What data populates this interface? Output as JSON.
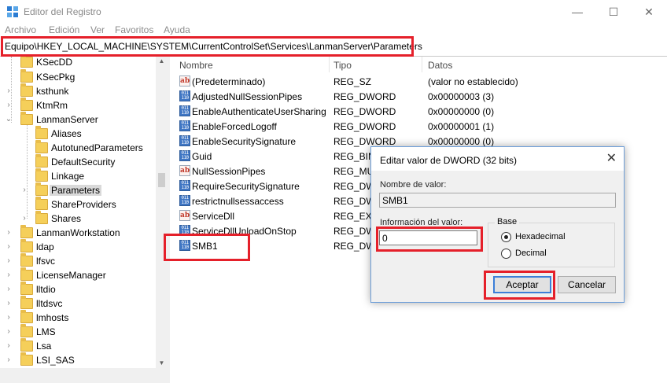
{
  "window": {
    "title": "Editor del Registro",
    "controls": {
      "minimize": "—",
      "maximize": "☐",
      "close": "✕"
    }
  },
  "menu": [
    "Archivo",
    "Edición",
    "Ver",
    "Favoritos",
    "Ayuda"
  ],
  "address": "Equipo\\HKEY_LOCAL_MACHINE\\SYSTEM\\CurrentControlSet\\Services\\LanmanServer\\Parameters",
  "tree": {
    "items": [
      {
        "label": "KSecDD"
      },
      {
        "label": "KSecPkg"
      },
      {
        "label": "ksthunk"
      },
      {
        "label": "KtmRm"
      },
      {
        "label": "LanmanServer"
      },
      {
        "label": "Aliases"
      },
      {
        "label": "AutotunedParameters"
      },
      {
        "label": "DefaultSecurity"
      },
      {
        "label": "Linkage"
      },
      {
        "label": "Parameters"
      },
      {
        "label": "ShareProviders"
      },
      {
        "label": "Shares"
      },
      {
        "label": "LanmanWorkstation"
      },
      {
        "label": "ldap"
      },
      {
        "label": "lfsvc"
      },
      {
        "label": "LicenseManager"
      },
      {
        "label": "lltdio"
      },
      {
        "label": "lltdsvc"
      },
      {
        "label": "lmhosts"
      },
      {
        "label": "LMS"
      },
      {
        "label": "Lsa"
      },
      {
        "label": "LSI_SAS"
      }
    ]
  },
  "list": {
    "columns": {
      "name": "Nombre",
      "type": "Tipo",
      "data": "Datos"
    },
    "rows": [
      {
        "name": "(Predeterminado)",
        "type": "REG_SZ",
        "data": "(valor no establecido)",
        "icon": "string-value-icon"
      },
      {
        "name": "AdjustedNullSessionPipes",
        "type": "REG_DWORD",
        "data": "0x00000003 (3)",
        "icon": "binary-value-icon"
      },
      {
        "name": "EnableAuthenticateUserSharing",
        "type": "REG_DWORD",
        "data": "0x00000000 (0)",
        "icon": "binary-value-icon"
      },
      {
        "name": "EnableForcedLogoff",
        "type": "REG_DWORD",
        "data": "0x00000001 (1)",
        "icon": "binary-value-icon"
      },
      {
        "name": "EnableSecuritySignature",
        "type": "REG_DWORD",
        "data": "0x00000000 (0)",
        "icon": "binary-value-icon"
      },
      {
        "name": "Guid",
        "type": "REG_BINA",
        "data": "",
        "icon": "binary-value-icon"
      },
      {
        "name": "NullSessionPipes",
        "type": "REG_MUL",
        "data": "",
        "icon": "string-value-icon"
      },
      {
        "name": "RequireSecuritySignature",
        "type": "REG_DWO",
        "data": "",
        "icon": "binary-value-icon"
      },
      {
        "name": "restrictnullsessaccess",
        "type": "REG_DWO",
        "data": "",
        "icon": "binary-value-icon"
      },
      {
        "name": "ServiceDll",
        "type": "REG_EXPA",
        "data": "",
        "icon": "string-value-icon"
      },
      {
        "name": "ServiceDllUnloadOnStop",
        "type": "REG_DWO",
        "data": "",
        "icon": "binary-value-icon"
      },
      {
        "name": "SMB1",
        "type": "REG_DWO",
        "data": "",
        "icon": "binary-value-icon"
      }
    ]
  },
  "dialog": {
    "title": "Editar valor de DWORD (32 bits)",
    "close": "✕",
    "value_name_label": "Nombre de valor:",
    "value_name": "SMB1",
    "value_data_label": "Información del valor:",
    "value_data": "0",
    "base_label": "Base",
    "hex_label": "Hexadecimal",
    "dec_label": "Decimal",
    "ok_label": "Aceptar",
    "cancel_label": "Cancelar"
  },
  "colors": {
    "highlight": "#e5202a",
    "accent": "#3c7fd8"
  }
}
